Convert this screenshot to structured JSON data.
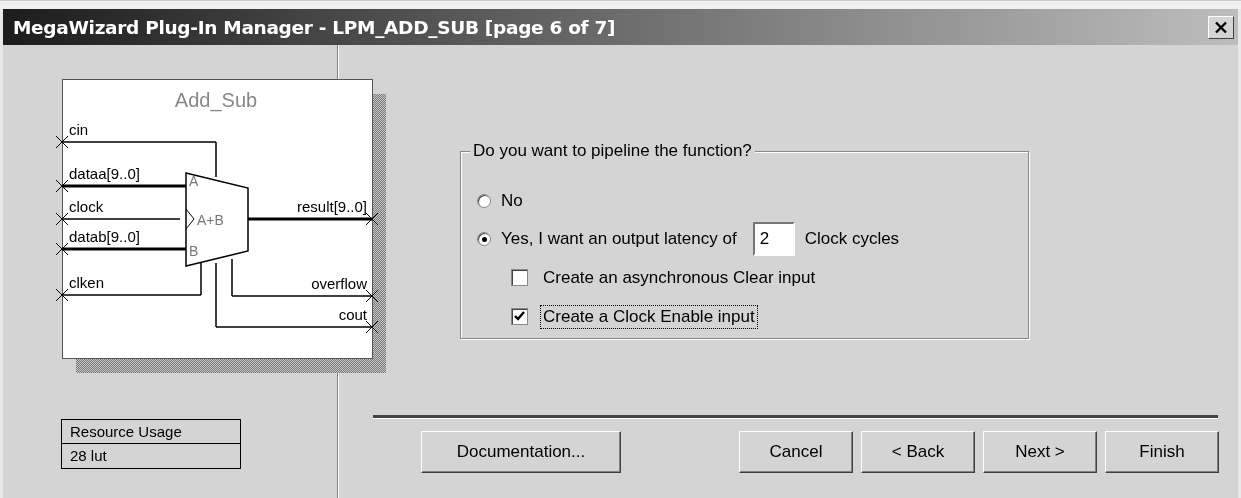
{
  "window": {
    "title": "MegaWizard Plug-In Manager - LPM_ADD_SUB [page 6 of 7]"
  },
  "diagram": {
    "title": "Add_Sub",
    "operator": "A+B",
    "port_a": "A",
    "port_b": "B",
    "inputs": [
      {
        "name": "cin",
        "bus": false
      },
      {
        "name": "dataa[9..0]",
        "bus": true
      },
      {
        "name": "clock",
        "bus": false
      },
      {
        "name": "datab[9..0]",
        "bus": true
      },
      {
        "name": "clken",
        "bus": false
      }
    ],
    "outputs": [
      {
        "name": "result[9..0]",
        "bus": true
      },
      {
        "name": "overflow",
        "bus": false
      },
      {
        "name": "cout",
        "bus": false
      }
    ]
  },
  "resource_usage": {
    "heading": "Resource Usage",
    "value": "28 lut"
  },
  "pipeline": {
    "legend": "Do you want to pipeline the function?",
    "options": [
      {
        "label": "No",
        "selected": false
      },
      {
        "label": "Yes, I want an output latency of",
        "selected": true,
        "value": "2",
        "suffix": "Clock cycles"
      }
    ],
    "checkboxes": [
      {
        "label": "Create an asynchronous Clear input",
        "checked": false,
        "focused": false
      },
      {
        "label": "Create a Clock Enable input",
        "checked": true,
        "focused": true
      }
    ]
  },
  "buttons": [
    {
      "label": "Documentation...",
      "kind": "help"
    },
    {
      "label": "Cancel",
      "kind": "nav"
    },
    {
      "label": "< Back",
      "kind": "nav"
    },
    {
      "label": "Next >",
      "kind": "nav"
    },
    {
      "label": "Finish",
      "kind": "nav"
    }
  ]
}
